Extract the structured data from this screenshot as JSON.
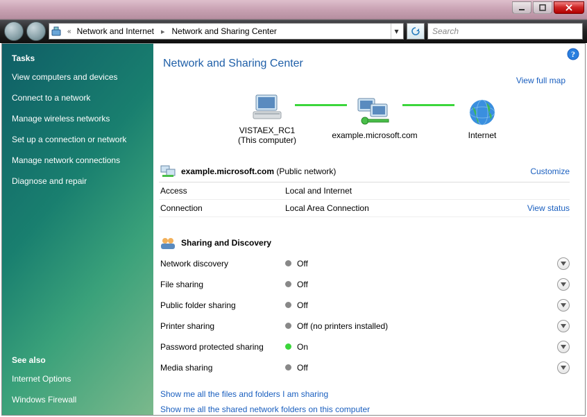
{
  "titlebar": {
    "min": "–",
    "max": "❐",
    "close": "✕"
  },
  "addressbar": {
    "crumb1": "Network and Internet",
    "crumb2": "Network and Sharing Center"
  },
  "search": {
    "placeholder": "Search"
  },
  "sidebar": {
    "tasks_heading": "Tasks",
    "items": [
      "View computers and devices",
      "Connect to a network",
      "Manage wireless networks",
      "Set up a connection or network",
      "Manage network connections",
      "Diagnose and repair"
    ],
    "see_also_heading": "See also",
    "see_also": [
      "Internet Options",
      "Windows Firewall"
    ]
  },
  "main": {
    "title": "Network and Sharing Center",
    "fullmap": "View full map",
    "node1": {
      "label": "VISTAEX_RC1",
      "sub": "(This computer)"
    },
    "node2": {
      "label": "example.microsoft.com"
    },
    "node3": {
      "label": "Internet"
    },
    "network_name": "example.microsoft.com",
    "network_type": " (Public network)",
    "customize": "Customize",
    "access_label": "Access",
    "access_value": "Local and Internet",
    "connection_label": "Connection",
    "connection_value": "Local Area Connection",
    "view_status": "View status",
    "sharing_heading": "Sharing and Discovery",
    "rows": [
      {
        "label": "Network discovery",
        "value": "Off",
        "on": false
      },
      {
        "label": "File sharing",
        "value": "Off",
        "on": false
      },
      {
        "label": "Public folder sharing",
        "value": "Off",
        "on": false
      },
      {
        "label": "Printer sharing",
        "value": "Off (no printers installed)",
        "on": false
      },
      {
        "label": "Password protected sharing",
        "value": "On",
        "on": true
      },
      {
        "label": "Media sharing",
        "value": "Off",
        "on": false
      }
    ],
    "link1": "Show me all the files and folders I am sharing",
    "link2": "Show me all the shared network folders on this computer"
  }
}
